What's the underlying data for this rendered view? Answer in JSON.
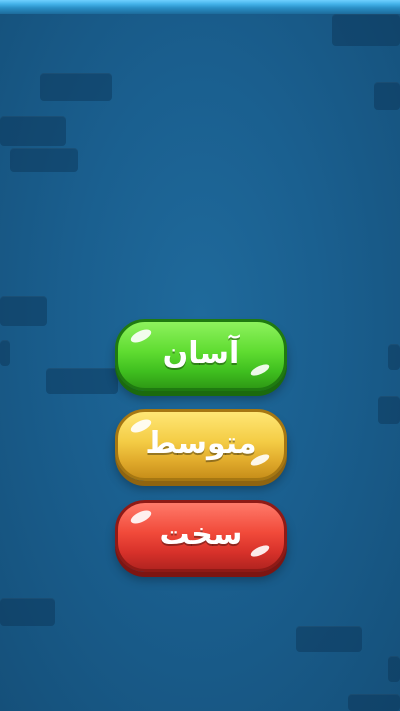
{
  "menu": {
    "easy_label": "آسان",
    "medium_label": "متوسط",
    "hard_label": "سخت"
  },
  "colors": {
    "background": "#1a5f8f",
    "easy": "#5fdc31",
    "medium": "#f4cc45",
    "hard": "#f14a3a"
  }
}
